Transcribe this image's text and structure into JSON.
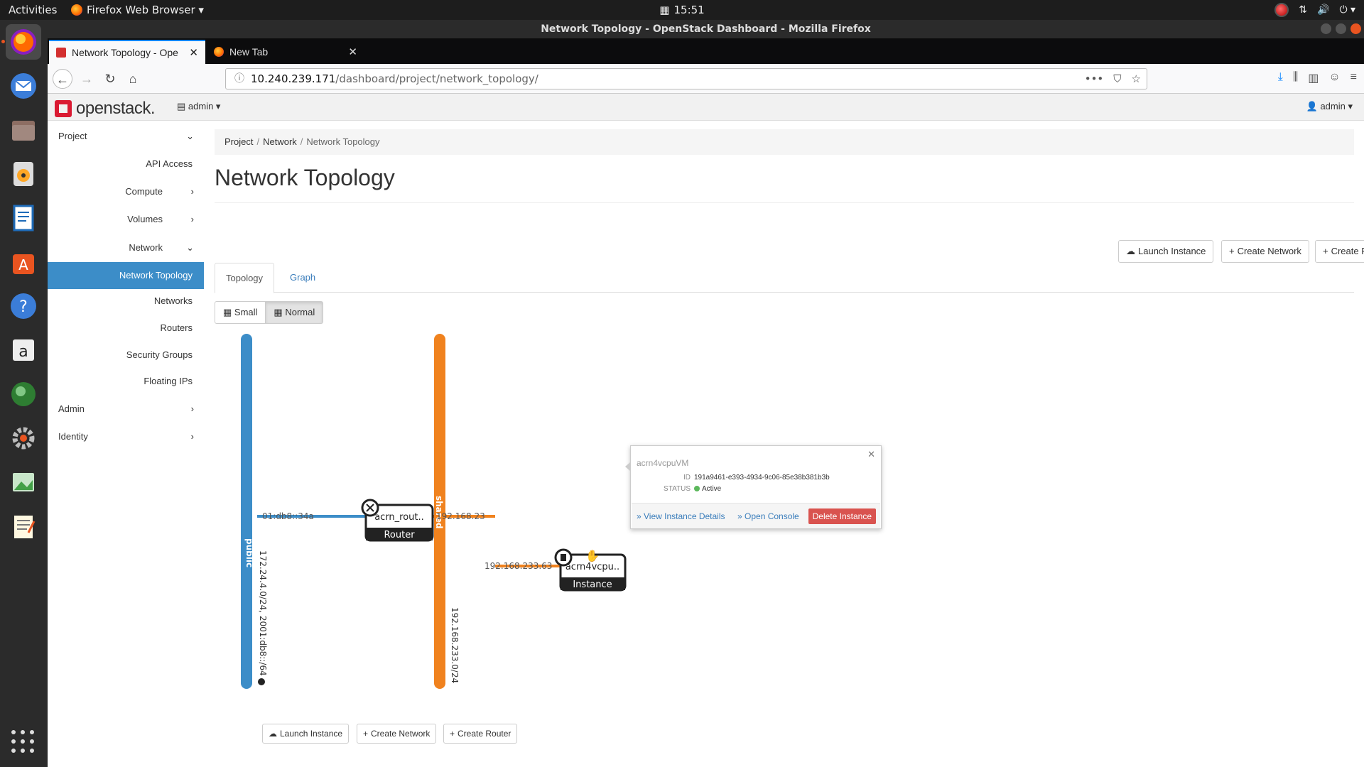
{
  "system": {
    "activities": "Activities",
    "app_menu": "Firefox Web Browser ▾",
    "clock": "15:51"
  },
  "window": {
    "title": "Network Topology - OpenStack Dashboard - Mozilla Firefox"
  },
  "tabs": [
    {
      "label": "Network Topology - Ope"
    },
    {
      "label": "New Tab"
    }
  ],
  "url": {
    "host": "10.240.239.171",
    "path": "/dashboard/project/network_topology/"
  },
  "header": {
    "logo": "openstack.",
    "project": "admin ▾",
    "user": "admin ▾"
  },
  "sidebar": {
    "items": [
      {
        "label": "Project"
      },
      {
        "label": "API Access"
      },
      {
        "label": "Compute"
      },
      {
        "label": "Volumes"
      },
      {
        "label": "Network"
      },
      {
        "label": "Network Topology"
      },
      {
        "label": "Networks"
      },
      {
        "label": "Routers"
      },
      {
        "label": "Security Groups"
      },
      {
        "label": "Floating IPs"
      },
      {
        "label": "Admin"
      },
      {
        "label": "Identity"
      }
    ]
  },
  "breadcrumb": {
    "project": "Project",
    "network": "Network",
    "current": "Network Topology"
  },
  "page": {
    "title": "Network Topology"
  },
  "actions": {
    "launch": "Launch Instance",
    "create_network": "Create Network",
    "create_router": "Create Router"
  },
  "view_tabs": {
    "topology": "Topology",
    "graph": "Graph"
  },
  "size": {
    "small": "Small",
    "normal": "Normal"
  },
  "colors": {
    "public_net": "#3c8dc8",
    "shared_net": "#f0821e",
    "active_tab_bg": "#3c8dc8",
    "delete": "#d9534f",
    "status_active": "#5cb85c"
  },
  "topology": {
    "networks": [
      {
        "name": "public",
        "cidr": "172.24.4.0/24, 2001:db8::/64"
      },
      {
        "name": "shared",
        "cidr": "192.168.233.0/24"
      }
    ],
    "router": {
      "name": "acrn_rout..",
      "type": "Router",
      "port_left": "01:db8::34a",
      "port_right": "192.168.23"
    },
    "instance": {
      "name": "acrn4vcpu..",
      "type": "Instance",
      "port": "192.168.233.63"
    }
  },
  "balloon": {
    "name": "acrn4vcpuVM",
    "id_label": "ID",
    "id": "191a9461-e393-4934-9c06-85e38b381b3b",
    "status_label": "STATUS",
    "status": "Active",
    "view_details": "» View Instance Details",
    "open_console": "» Open Console",
    "delete": "Delete Instance"
  }
}
